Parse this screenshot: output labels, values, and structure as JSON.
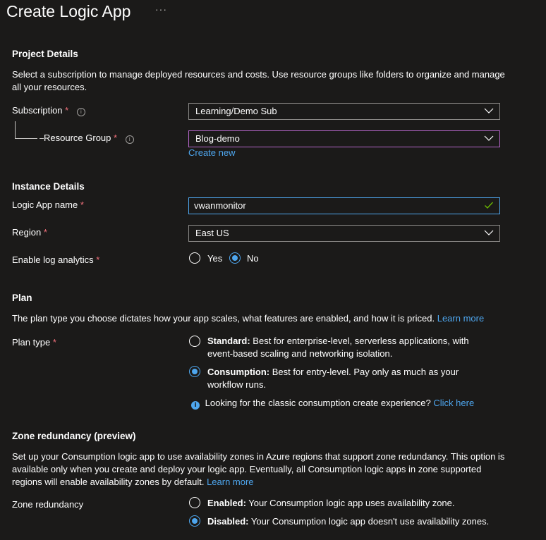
{
  "page": {
    "title": "Create Logic App",
    "more": "···"
  },
  "project": {
    "heading": "Project Details",
    "description": "Select a subscription to manage deployed resources and costs. Use resource groups like folders to organize and manage all your resources.",
    "subscription_label": "Subscription",
    "subscription_value": "Learning/Demo Sub",
    "resource_group_label": "Resource Group",
    "resource_group_value": "Blog-demo",
    "create_new": "Create new"
  },
  "instance": {
    "heading": "Instance Details",
    "name_label": "Logic App name",
    "name_value": "vwanmonitor",
    "region_label": "Region",
    "region_value": "East US",
    "log_label": "Enable log analytics",
    "log_yes": "Yes",
    "log_no": "No",
    "log_selected": "No"
  },
  "plan": {
    "heading": "Plan",
    "description": "The plan type you choose dictates how your app scales, what features are enabled, and how it is priced.",
    "learn_more": "Learn more",
    "type_label": "Plan type",
    "standard_title": "Standard:",
    "standard_desc": "Best for enterprise-level, serverless applications, with event-based scaling and networking isolation.",
    "consumption_title": "Consumption:",
    "consumption_desc": "Best for entry-level. Pay only as much as your workflow runs.",
    "selected": "Consumption",
    "classic_note": "Looking for the classic consumption create experience?",
    "click_here": "Click here"
  },
  "zone": {
    "heading": "Zone redundancy (preview)",
    "description": "Set up your Consumption logic app to use availability zones in Azure regions that support zone redundancy. This option is available only when you create and deploy your logic app. Eventually, all Consumption logic apps in zone supported regions will enable availability zones by default.",
    "learn_more": "Learn more",
    "label": "Zone redundancy",
    "enabled_title": "Enabled:",
    "enabled_desc": "Your Consumption logic app uses availability zone.",
    "disabled_title": "Disabled:",
    "disabled_desc": "Your Consumption logic app doesn't use availability zones.",
    "selected": "Disabled"
  },
  "common": {
    "required_mark": "*",
    "info_glyph": "i"
  }
}
